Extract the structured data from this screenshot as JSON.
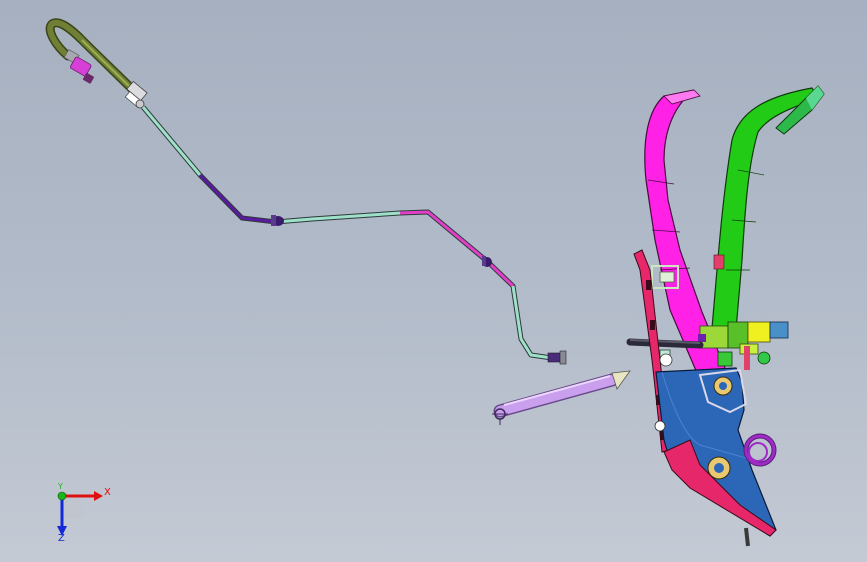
{
  "viewport": {
    "background_top": "#a6b0c0",
    "background_bottom": "#c4cad4"
  },
  "colors": {
    "hose": "#6f7f36",
    "connector": "#d640d6",
    "line_light": "#9fe0c8",
    "line_purple": "#5a1aa0",
    "line_magenta": "#e23fc8",
    "pedal_magenta": "#ff21e6",
    "pedal_green": "#22cc16",
    "bracket_blue": "#2c67b7",
    "bracket_red": "#e6286a",
    "spring_purple": "#9d2bc4",
    "rod_lilac": "#caa0ee"
  },
  "triad": {
    "x_label": "X",
    "y_label": "Y",
    "z_label": "Z",
    "x_color": "#e01010",
    "y_color": "#18b818",
    "z_color": "#1428d8"
  }
}
